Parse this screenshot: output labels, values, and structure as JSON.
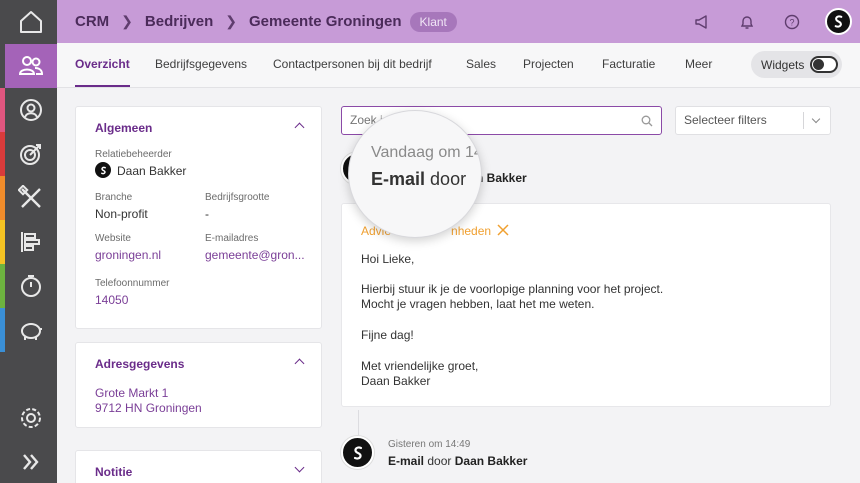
{
  "breadcrumb": {
    "items": [
      "CRM",
      "Bedrijven",
      "Gemeente Groningen"
    ],
    "badge": "Klant"
  },
  "topbar_icons": [
    "megaphone-icon",
    "bell-icon",
    "help-icon",
    "account-logo"
  ],
  "rail": {
    "items": [
      "home-icon",
      "contacts-icon",
      "person-icon",
      "target-icon",
      "tools-icon",
      "planning-icon",
      "timer-icon",
      "piggy-bank-icon",
      "settings-icon",
      "expand-icon"
    ],
    "stripe_colors": [
      "#e0567f",
      "#d93b3b",
      "#f08c2b",
      "#f5c323",
      "#6db33f",
      "#3a8fd6"
    ]
  },
  "tabs": [
    "Overzicht",
    "Bedrijfsgegevens",
    "Contactpersonen bij dit bedrijf",
    "Sales",
    "Projecten",
    "Facturatie",
    "Meer"
  ],
  "widgets_label": "Widgets",
  "general": {
    "title": "Algemeen",
    "relation_manager_label": "Relatiebeheerder",
    "relation_manager": "Daan Bakker",
    "branche_label": "Branche",
    "branche": "Non-profit",
    "size_label": "Bedrijfsgrootte",
    "size": "-",
    "website_label": "Website",
    "website": "groningen.nl",
    "email_label": "E-mailadres",
    "email": "gemeente@gron...",
    "phone_label": "Telefoonnummer",
    "phone": "14050"
  },
  "address": {
    "title": "Adresgegevens",
    "line1": "Grote Markt 1",
    "line2": "9712 HN Groningen"
  },
  "note": {
    "title": "Notitie"
  },
  "search": {
    "placeholder": "Zoek i"
  },
  "filter": {
    "label": "Selecteer filters"
  },
  "timeline": [
    {
      "time": "Vandaag om 14",
      "type": "E-mail",
      "by": "door",
      "author_partial": "n Bakker",
      "subject_visible": "Advie",
      "subject_tail": "nheden",
      "body": [
        "Hoi Lieke,",
        "Hierbij stuur ik je de voorlopige planning voor het project.",
        "Mocht je vragen hebben, laat het me weten.",
        "Fijne dag!",
        "Met vriendelijke groet,",
        "Daan Bakker"
      ]
    },
    {
      "time": "Gisteren om 14:49",
      "type": "E-mail",
      "by": "door",
      "author": "Daan Bakker"
    }
  ],
  "colors": {
    "accent": "#6a2c8a",
    "topbar": "#c79bd7",
    "rail": "#4a4a4c",
    "subject_orange": "#f0a030"
  }
}
